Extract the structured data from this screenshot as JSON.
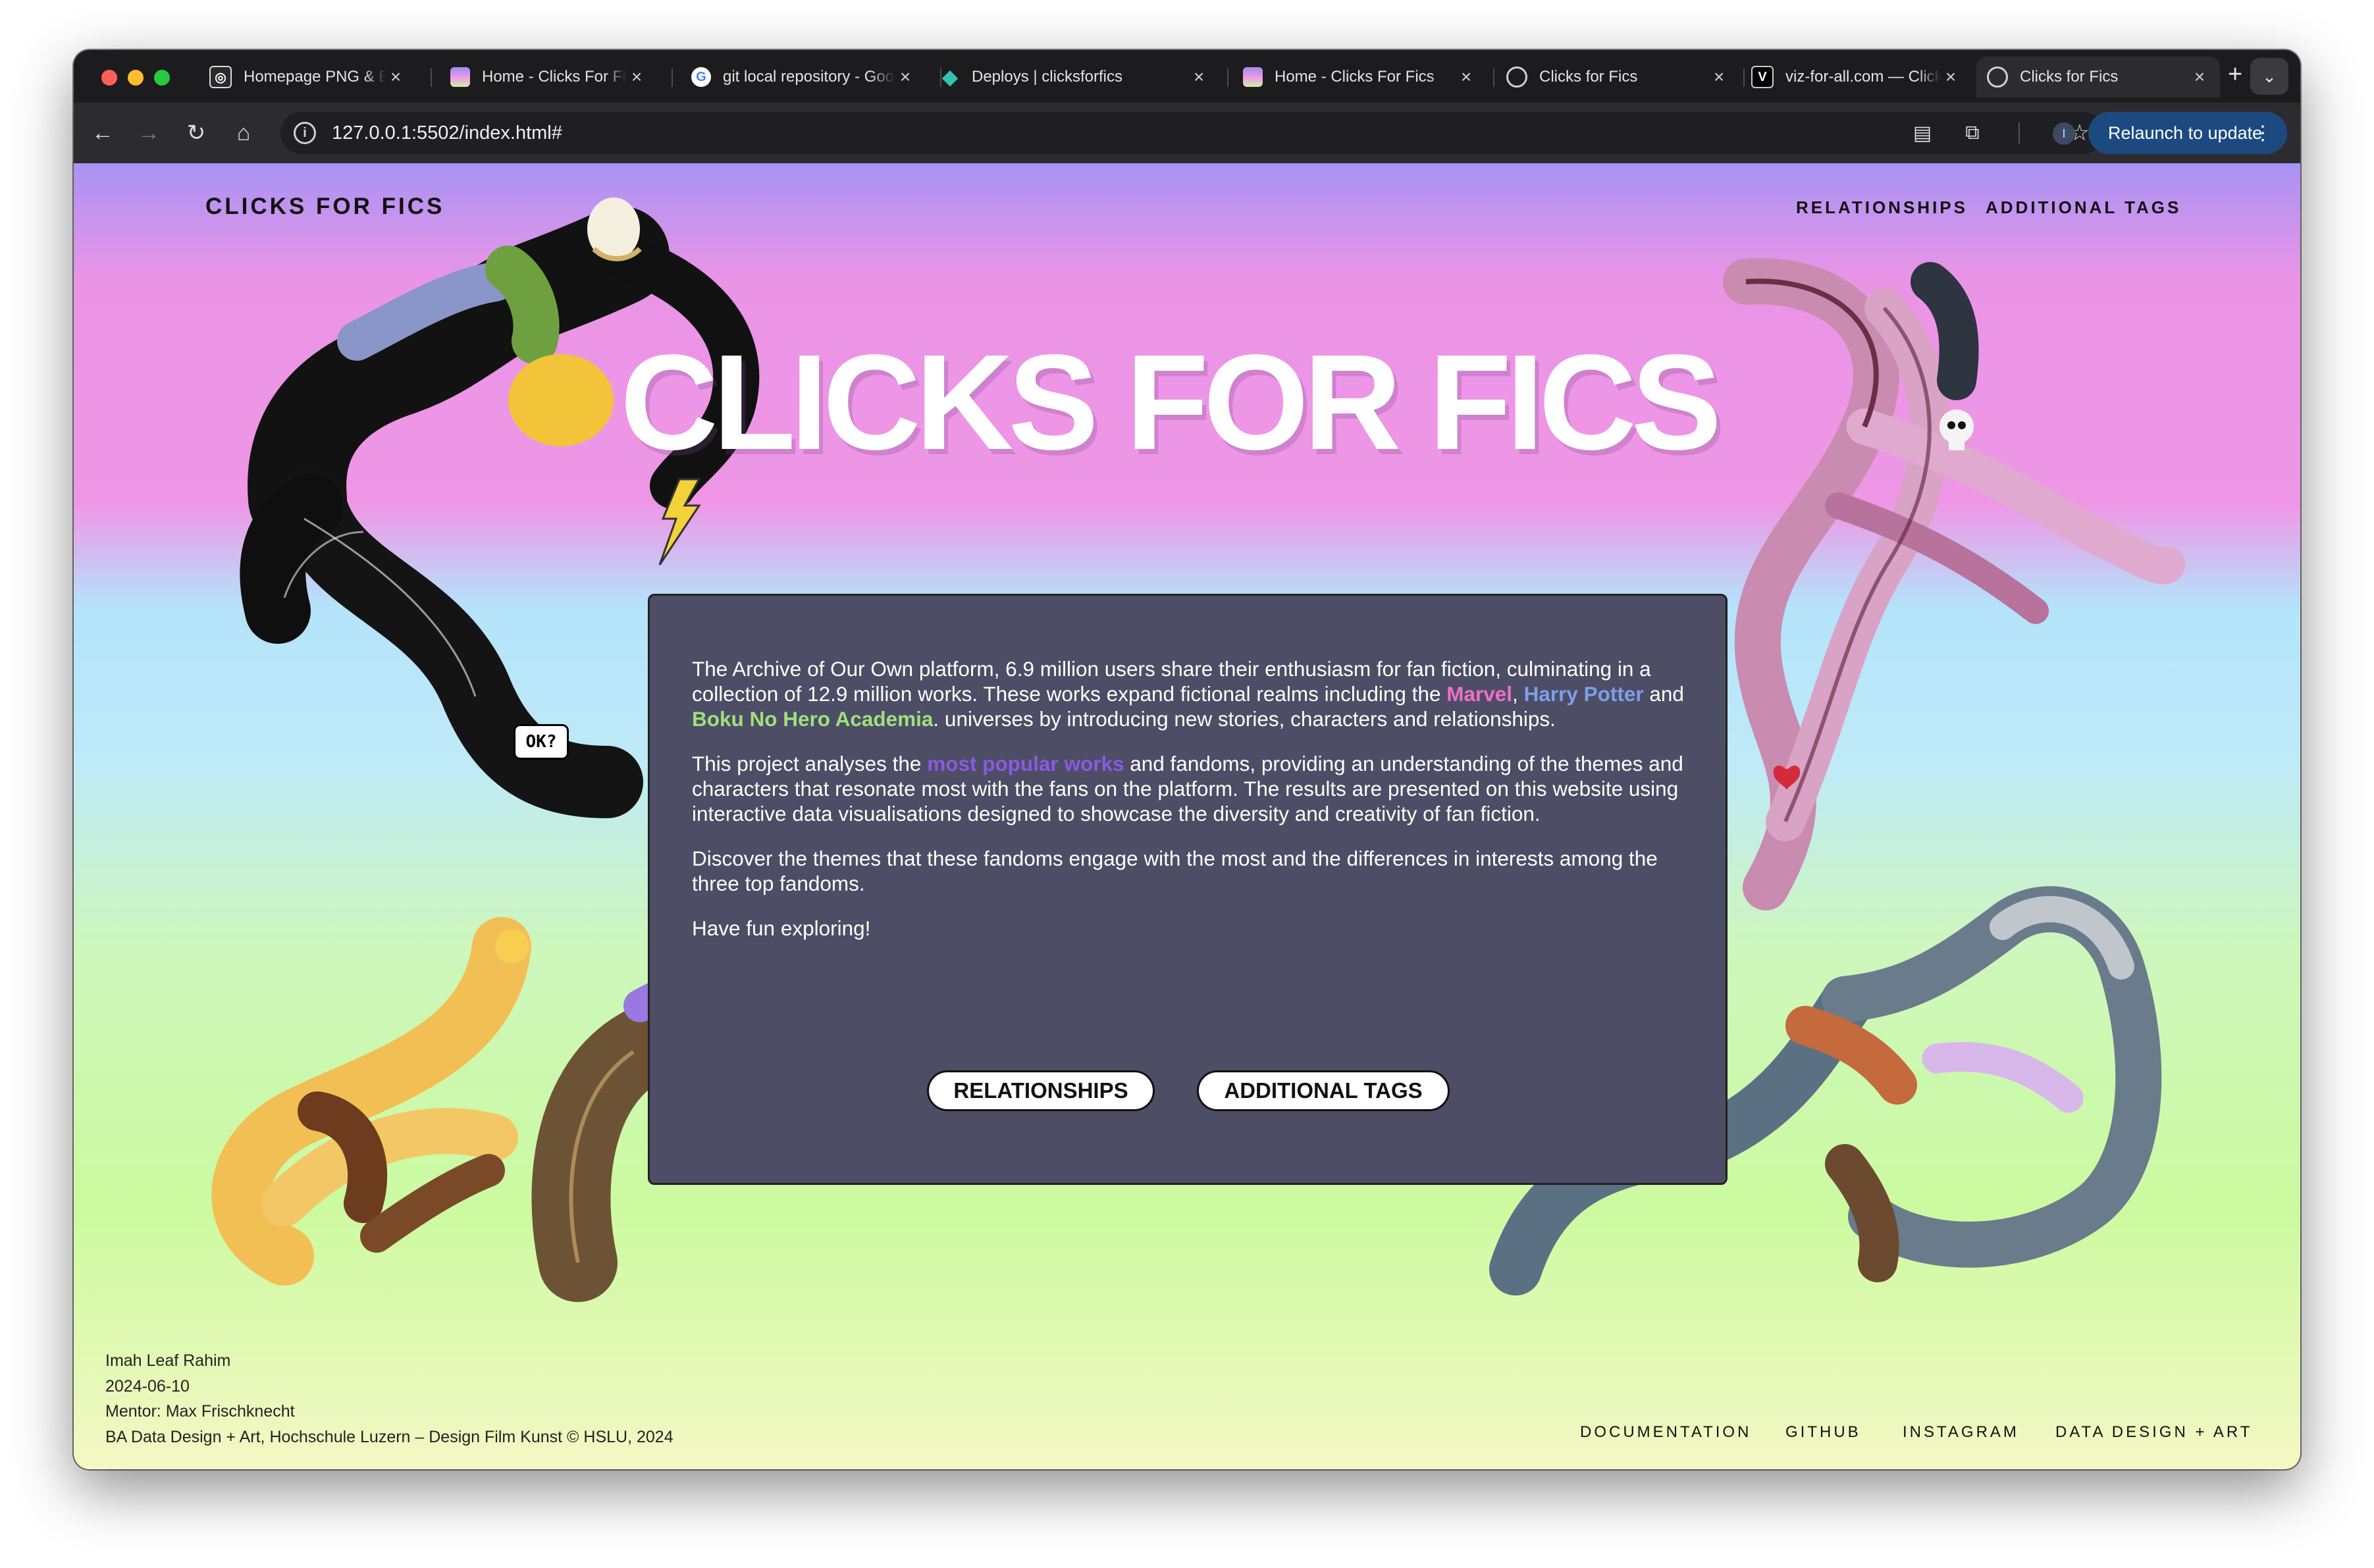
{
  "browser": {
    "tabs": [
      {
        "title": "Homepage PNG & Backgrounds",
        "favicon": "pngtree-icon"
      },
      {
        "title": "Home - Clicks For Fics",
        "favicon": "site-image-icon"
      },
      {
        "title": "git local repository - Google Search",
        "favicon": "google-icon"
      },
      {
        "title": "Deploys | clicksforfics",
        "favicon": "netlify-icon"
      },
      {
        "title": "Home - Clicks For Fics",
        "favicon": "site-image-icon"
      },
      {
        "title": "Clicks for Fics",
        "favicon": "globe-icon"
      },
      {
        "title": "viz-for-all.com — Clicks for Fics",
        "favicon": "vercel-icon"
      },
      {
        "title": "Clicks for Fics",
        "favicon": "globe-icon",
        "active": true
      }
    ],
    "url": "127.0.0.1:5502/index.html#",
    "relaunch_label": "Relaunch to update",
    "profile_initial": "I"
  },
  "site": {
    "brand": "CLICKS FOR FICS",
    "nav": {
      "relationships": "RELATIONSHIPS",
      "additional_tags": "ADDITIONAL TAGS"
    },
    "hero_title": "CLICKS FOR FICS",
    "intro": {
      "p1_a": "The Archive of Our Own platform, 6.9 million users share their enthusiasm for fan fiction, culminating in a collection of 12.9 million works. These works expand fictional realms including the ",
      "marvel": "Marvel",
      "comma": ", ",
      "harry_potter": "Harry Potter",
      "and": " and ",
      "boku": "Boku No Hero Academia",
      "p1_b": ". universes by introducing new stories, characters and relationships.",
      "p2_a": "This project analyses the ",
      "most_popular": "most popular works",
      "p2_b": " and fandoms, providing an understanding of the themes and characters that resonate most with the fans on the platform. The results are presented on this website using interactive data visualisations designed to showcase the diversity and creativity of fan fiction.",
      "p3": "Discover the themes that these fandoms engage with the most and the differences in interests among the three top fandoms.",
      "p4": "Have fun exploring!"
    },
    "buttons": {
      "relationships": "RELATIONSHIPS",
      "additional_tags": "ADDITIONAL TAGS"
    },
    "sticker_text": "OK?",
    "credits": {
      "author": "Imah Leaf Rahim",
      "date": "2024-06-10",
      "mentor": "Mentor: Max Frischknecht",
      "program": "BA Data Design + Art, Hochschule Luzern – Design Film Kunst © HSLU, 2024"
    },
    "footer_nav": {
      "documentation": "DOCUMENTATION",
      "github": "GITHUB",
      "instagram": "INSTAGRAM",
      "data_design_art": "DATA DESIGN + ART"
    }
  }
}
